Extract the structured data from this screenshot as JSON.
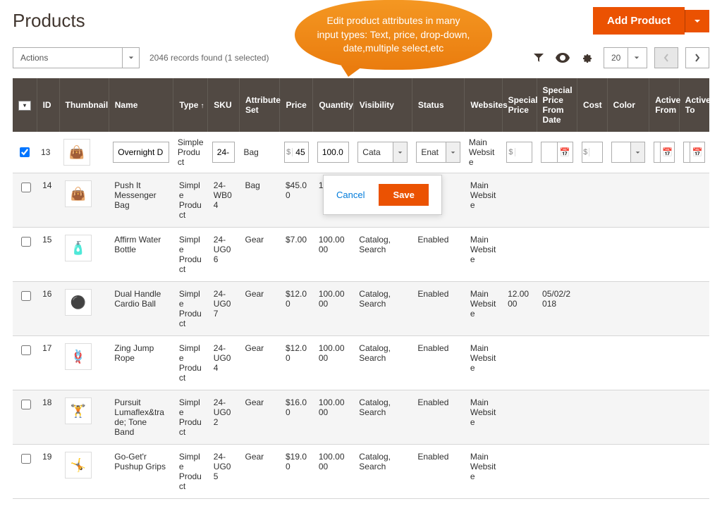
{
  "page": {
    "title": "Products"
  },
  "addBtn": {
    "label": "Add Product"
  },
  "actionsSelect": {
    "label": "Actions"
  },
  "recordsFound": "2046 records found (1 selected)",
  "pageSize": "20",
  "callout": "Edit product attributes in many input types: Text, price, drop-down, date,multiple select,etc",
  "rowActions": {
    "cancel": "Cancel",
    "save": "Save"
  },
  "columns": [
    {
      "key": "chk",
      "label": ""
    },
    {
      "key": "id",
      "label": "ID"
    },
    {
      "key": "thumb",
      "label": "Thumbnail"
    },
    {
      "key": "name",
      "label": "Name"
    },
    {
      "key": "type",
      "label": "Type",
      "sort": "↑"
    },
    {
      "key": "sku",
      "label": "SKU"
    },
    {
      "key": "attrset",
      "label": "Attribute Set"
    },
    {
      "key": "price",
      "label": "Price"
    },
    {
      "key": "qty",
      "label": "Quantity"
    },
    {
      "key": "vis",
      "label": "Visibility"
    },
    {
      "key": "status",
      "label": "Status"
    },
    {
      "key": "web",
      "label": "Websites"
    },
    {
      "key": "sprice",
      "label": "Special Price"
    },
    {
      "key": "spdate",
      "label": "Special Price From Date"
    },
    {
      "key": "cost",
      "label": "Cost"
    },
    {
      "key": "color",
      "label": "Color"
    },
    {
      "key": "afrom",
      "label": "Active From"
    },
    {
      "key": "ato",
      "label": "Active To"
    }
  ],
  "editRow": {
    "id": "13",
    "name": "Overnight D",
    "type": "Simple Product",
    "sku": "24-",
    "attrset": "Bag",
    "price": "45",
    "qty": "100.0",
    "visibility": "Cata",
    "status": "Enat",
    "websites": "Main Website"
  },
  "rows": [
    {
      "id": "14",
      "name": "Push It Messenger Bag",
      "type": "Simple Product",
      "sku": "24-WB04",
      "attrset": "Bag",
      "price": "$45.00",
      "qty": "1",
      "vis": "",
      "status": "",
      "web": "Main Website",
      "sprice": "",
      "spdate": "",
      "cost": "",
      "color": "",
      "afrom": "",
      "ato": ""
    },
    {
      "id": "15",
      "name": "Affirm Water Bottle",
      "type": "Simple Product",
      "sku": "24-UG06",
      "attrset": "Gear",
      "price": "$7.00",
      "qty": "100.0000",
      "vis": "Catalog, Search",
      "status": "Enabled",
      "web": "Main Website",
      "sprice": "",
      "spdate": "",
      "cost": "",
      "color": "",
      "afrom": "",
      "ato": ""
    },
    {
      "id": "16",
      "name": "Dual Handle Cardio Ball",
      "type": "Simple Product",
      "sku": "24-UG07",
      "attrset": "Gear",
      "price": "$12.00",
      "qty": "100.0000",
      "vis": "Catalog, Search",
      "status": "Enabled",
      "web": "Main Website",
      "sprice": "12.0000",
      "spdate": "05/02/2018",
      "cost": "",
      "color": "",
      "afrom": "",
      "ato": ""
    },
    {
      "id": "17",
      "name": "Zing Jump Rope",
      "type": "Simple Product",
      "sku": "24-UG04",
      "attrset": "Gear",
      "price": "$12.00",
      "qty": "100.0000",
      "vis": "Catalog, Search",
      "status": "Enabled",
      "web": "Main Website",
      "sprice": "",
      "spdate": "",
      "cost": "",
      "color": "",
      "afrom": "",
      "ato": ""
    },
    {
      "id": "18",
      "name": "Pursuit Lumaflex&trade; Tone Band",
      "type": "Simple Product",
      "sku": "24-UG02",
      "attrset": "Gear",
      "price": "$16.00",
      "qty": "100.0000",
      "vis": "Catalog, Search",
      "status": "Enabled",
      "web": "Main Website",
      "sprice": "",
      "spdate": "",
      "cost": "",
      "color": "",
      "afrom": "",
      "ato": ""
    },
    {
      "id": "19",
      "name": "Go-Get'r Pushup Grips",
      "type": "Simple Product",
      "sku": "24-UG05",
      "attrset": "Gear",
      "price": "$19.00",
      "qty": "100.0000",
      "vis": "Catalog, Search",
      "status": "Enabled",
      "web": "Main Website",
      "sprice": "",
      "spdate": "",
      "cost": "",
      "color": "",
      "afrom": "",
      "ato": ""
    }
  ]
}
